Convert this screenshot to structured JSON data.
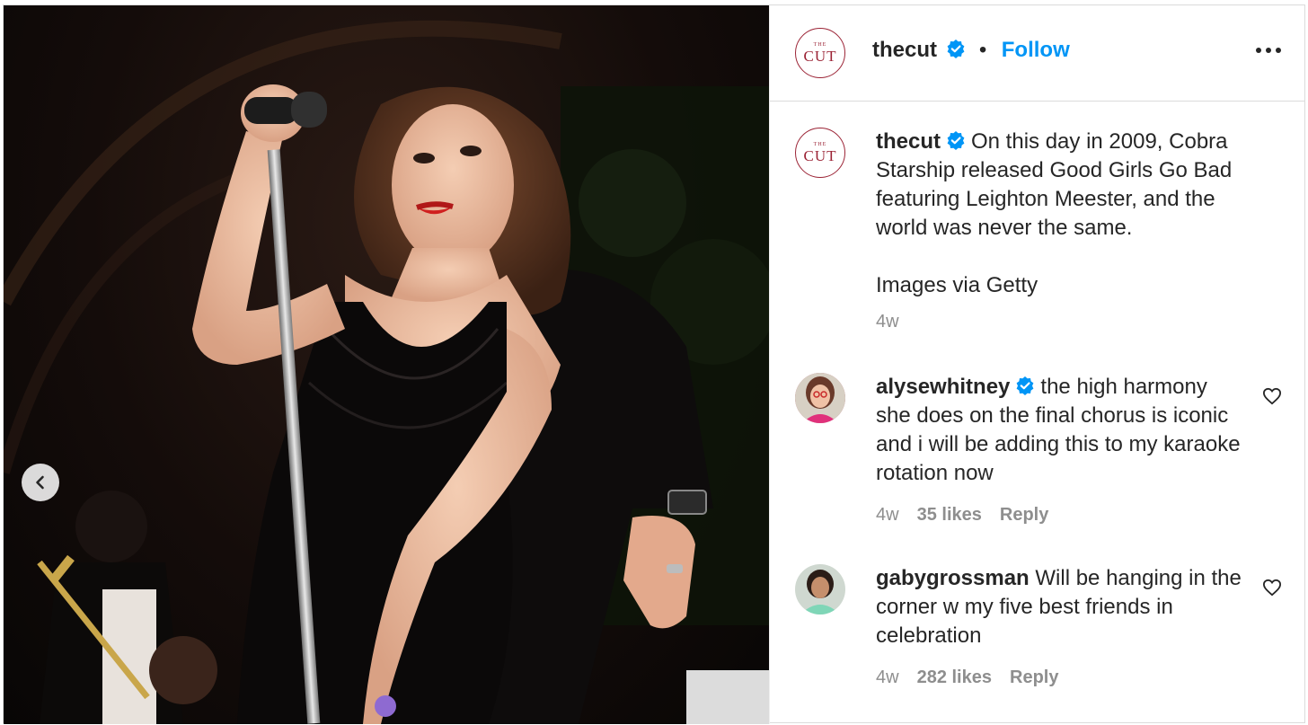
{
  "header": {
    "avatar_top": "THE",
    "avatar_main": "CUT",
    "username": "thecut",
    "separator": "•",
    "follow_label": "Follow"
  },
  "caption": {
    "username": "thecut",
    "text": "On this day in 2009, Cobra Starship released Good Girls Go Bad featuring Leighton Meester, and the world was never the same.",
    "credit": "Images via Getty",
    "time": "4w"
  },
  "comments": [
    {
      "username": "alysewhitney",
      "verified": true,
      "text": "the high harmony she does on the final chorus is iconic and i will be adding this to my karaoke rotation now",
      "time": "4w",
      "likes": "35 likes",
      "reply": "Reply"
    },
    {
      "username": "gabygrossman",
      "verified": false,
      "text": "Will be hanging in the corner w my five best friends in celebration",
      "time": "4w",
      "likes": "282 likes",
      "reply": "Reply"
    }
  ],
  "colors": {
    "accent": "#0095f6",
    "brand": "#9b2335",
    "muted": "#8e8e8e",
    "text": "#262626"
  },
  "icons": {
    "verified": "verified-badge-icon",
    "more": "more-options-icon",
    "like": "heart-icon",
    "previous": "chevron-left-icon"
  }
}
